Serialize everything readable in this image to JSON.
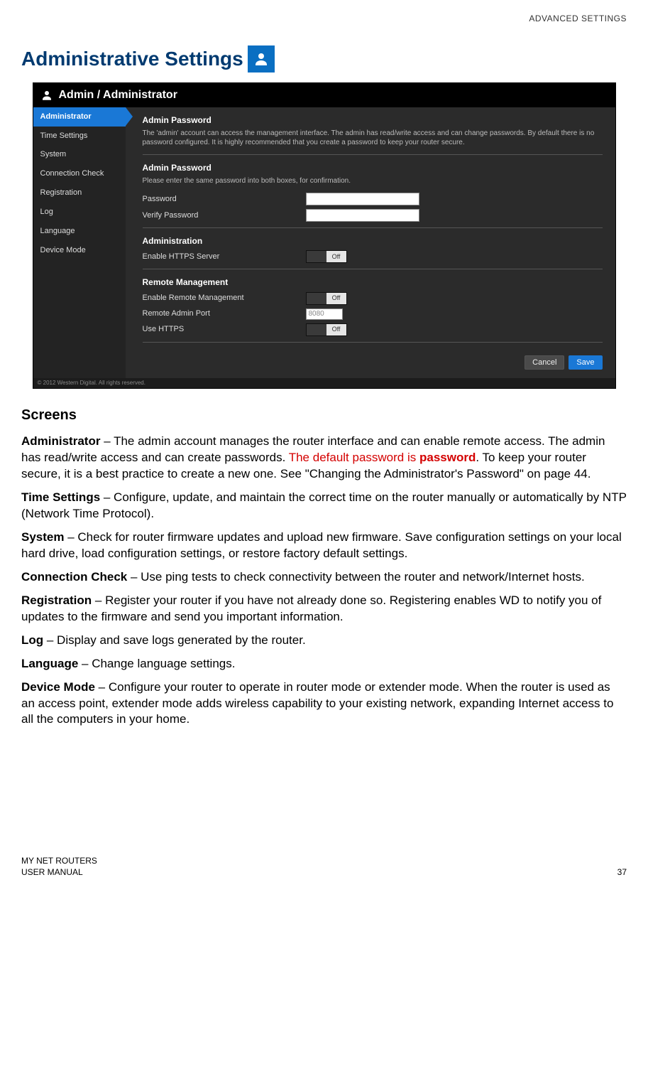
{
  "header_tag": "ADVANCED SETTINGS",
  "page_title": "Administrative Settings",
  "shot": {
    "breadcrumb": "Admin / Administrator",
    "sidebar": [
      "Administrator",
      "Time Settings",
      "System",
      "Connection Check",
      "Registration",
      "Log",
      "Language",
      "Device Mode"
    ],
    "sec1_title": "Admin Password",
    "sec1_desc": "The 'admin' account can access the management interface. The admin has read/write access and can change passwords. By default there is no password configured. It is highly recommended that you create a password to keep your router secure.",
    "sec2_title": "Admin Password",
    "sec2_desc": "Please enter the same password into both boxes, for confirmation.",
    "row_password": "Password",
    "row_verify": "Verify Password",
    "sec3_title": "Administration",
    "row_https": "Enable HTTPS Server",
    "sec4_title": "Remote Management",
    "row_remote_enable": "Enable Remote Management",
    "row_remote_port": "Remote Admin Port",
    "row_remote_port_value": "8080",
    "row_use_https": "Use HTTPS",
    "toggle_off": "Off",
    "btn_cancel": "Cancel",
    "btn_save": "Save",
    "copyright": "© 2012 Western Digital. All rights reserved."
  },
  "screens_heading": "Screens",
  "paragraphs": {
    "admin_label": "Administrator",
    "admin_text_a": " – The admin account manages the router interface and can enable remote access. The admin has read/write access and can create passwords. ",
    "admin_red_a": "The default password is ",
    "admin_red_b": "password",
    "admin_text_b": ". To keep your router secure, it is a best practice to create a new one. See \"Changing the Administrator's Password\" on page 44.",
    "time_label": "Time Settings",
    "time_text": " – Configure, update, and maintain the correct time on the router manually or automatically by NTP (Network Time Protocol).",
    "system_label": "System",
    "system_text": " – Check for router firmware updates and upload new firmware. Save configuration settings on your local hard drive, load configuration settings, or restore factory default settings.",
    "conn_label": "Connection Check",
    "conn_text": " – Use ping tests to check connectivity between the router and network/Internet hosts.",
    "reg_label": "Registration",
    "reg_text": " – Register your router if you have not already done so. Registering enables WD to notify you of updates to the firmware and send you important information.",
    "log_label": "Log",
    "log_text": " – Display and save logs generated by the router.",
    "lang_label": "Language",
    "lang_text": " – Change language settings.",
    "dev_label": "Device Mode",
    "dev_text": " – Configure your router to operate in router mode or extender mode. When the router is used as an access point, extender mode adds wireless capability to your existing network, expanding Internet access to all the computers in your home."
  },
  "footer": {
    "line1": "MY NET ROUTERS",
    "line2": "USER MANUAL",
    "page": "37"
  }
}
